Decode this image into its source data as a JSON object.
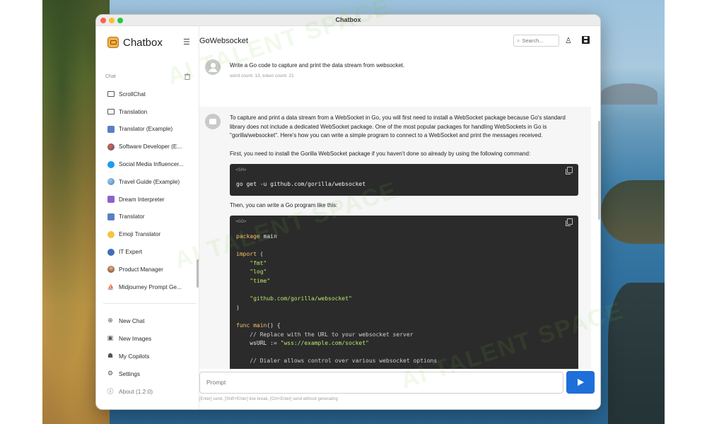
{
  "window": {
    "title": "Chatbox"
  },
  "brand": {
    "name": "Chatbox"
  },
  "sidebar": {
    "section_label": "Chat",
    "conversations": [
      {
        "label": "ScrollChat",
        "icon": "chat-bubble-icon"
      },
      {
        "label": "Translation",
        "icon": "chat-bubble-icon"
      },
      {
        "label": "Translator (Example)",
        "icon": "translator-avatar-icon"
      },
      {
        "label": "Software Developer (E...",
        "icon": "developer-avatar-icon"
      },
      {
        "label": "Social Media Influencer...",
        "icon": "twitter-avatar-icon"
      },
      {
        "label": "Travel Guide (Example)",
        "icon": "globe-avatar-icon"
      },
      {
        "label": "Dream Interpreter",
        "icon": "dream-avatar-icon"
      },
      {
        "label": "Translator",
        "icon": "translator-avatar-icon"
      },
      {
        "label": "Emoji Translator",
        "icon": "emoji-avatar-icon"
      },
      {
        "label": "IT Expert",
        "icon": "it-expert-avatar-icon"
      },
      {
        "label": "Product Manager",
        "icon": "product-manager-avatar-icon"
      },
      {
        "label": "Midjourney Prompt Ge...",
        "icon": "midjourney-avatar-icon"
      }
    ],
    "actions": [
      {
        "label": "New Chat",
        "icon": "plus-circle-icon"
      },
      {
        "label": "New Images",
        "icon": "image-icon"
      },
      {
        "label": "My Copilots",
        "icon": "robot-icon"
      },
      {
        "label": "Settings",
        "icon": "gear-icon"
      },
      {
        "label": "About (1.2.0)",
        "icon": "info-icon"
      }
    ]
  },
  "header": {
    "conversation_title": "GoWebsocket",
    "search_placeholder": "Search..."
  },
  "messages": {
    "user": {
      "text": "Write a Go code to capture and print the data stream from websocket.",
      "meta": "word count: 13, token count: 21"
    },
    "assistant": {
      "para1": "To capture and print a data stream from a WebSocket in Go, you will first need to install a WebSocket package because Go's standard library does not include a dedicated WebSocket package. One of the most popular packages for handling WebSockets in Go is \"gorilla/websocket\". Here's how you can write a simple program to connect to a WebSocket and print the messages received.",
      "para2": "First, you need to install the Gorilla WebSocket package if you haven't done so already by using the following command:",
      "code1_lang": "<SH>",
      "code1": "go get -u github.com/gorilla/websocket",
      "para3": "Then, you can write a Go program like this:",
      "code2_lang": "<GO>",
      "code2": {
        "l1_kw": "package",
        "l1_rest": " main",
        "l3_kw": "import",
        "l3_rest": " (",
        "l4": "\"fmt\"",
        "l5": "\"log\"",
        "l6": "\"time\"",
        "l8": "\"github.com/gorilla/websocket\"",
        "l9": ")",
        "l11_kw": "func",
        "l11_fn": " main",
        "l11_rest": "() {",
        "l12": "// Replace with the URL to your websocket server",
        "l13_a": "wsURL := ",
        "l13_str": "\"wss://example.com/socket\"",
        "l15": "// Dialer allows control over various websocket options"
      }
    }
  },
  "composer": {
    "placeholder": "Prompt",
    "hint": "[Enter] send, [Shift+Enter] line break, [Ctrl+Enter] send without generating"
  },
  "watermark": "AI TALENT SPACE"
}
